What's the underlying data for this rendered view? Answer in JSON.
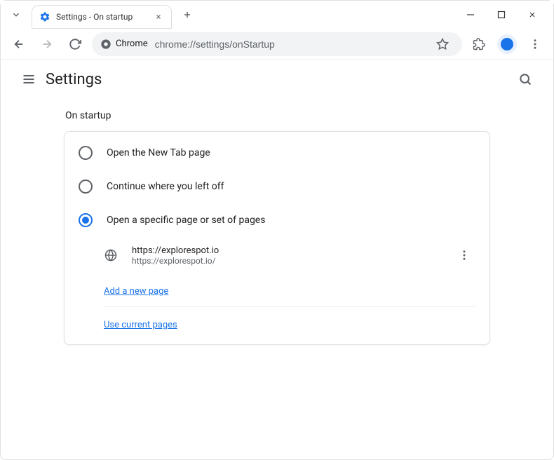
{
  "window": {
    "tab_title": "Settings - On startup"
  },
  "toolbar": {
    "chrome_label": "Chrome",
    "url": "chrome://settings/onStartup"
  },
  "header": {
    "title": "Settings"
  },
  "section": {
    "title": "On startup"
  },
  "options": {
    "new_tab": "Open the New Tab page",
    "continue": "Continue where you left off",
    "specific": "Open a specific page or set of pages"
  },
  "page_entry": {
    "title": "https://explorespot.io",
    "url": "https://explorespot.io/"
  },
  "links": {
    "add_page": "Add a new page",
    "use_current": "Use current pages"
  }
}
